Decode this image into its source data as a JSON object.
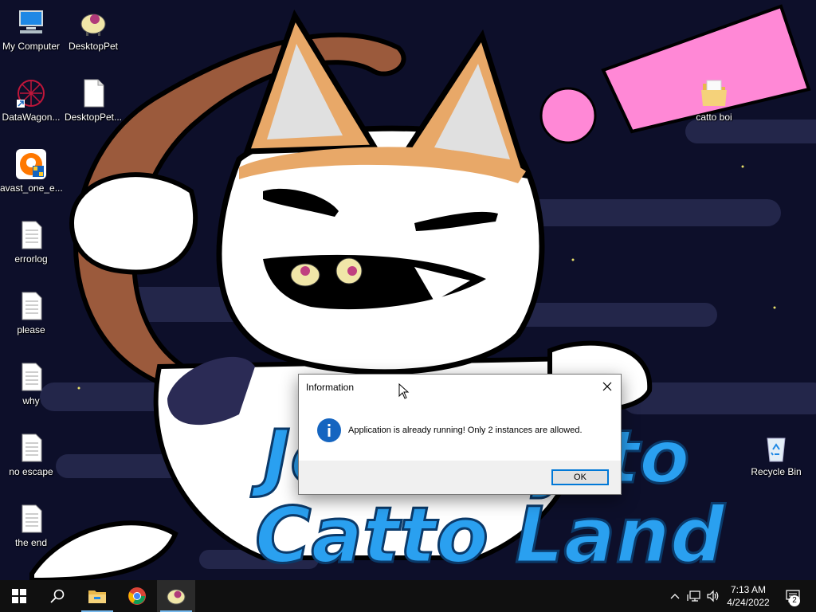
{
  "wallpaper": {
    "line1": "Journey to",
    "line2": "Catto Land"
  },
  "desktop_icons": [
    {
      "label": "My Computer",
      "icon": "computer-icon"
    },
    {
      "label": "DesktopPet",
      "icon": "sheep-icon"
    },
    {
      "label": "DataWagon...",
      "icon": "datawagon-icon"
    },
    {
      "label": "DesktopPet...",
      "icon": "document-icon"
    },
    {
      "label": "avast_one_e...",
      "icon": "avast-icon"
    },
    {
      "label": "errorlog",
      "icon": "text-file-icon"
    },
    {
      "label": "please",
      "icon": "text-file-icon"
    },
    {
      "label": "why",
      "icon": "text-file-icon"
    },
    {
      "label": "no escape",
      "icon": "text-file-icon"
    },
    {
      "label": "the end",
      "icon": "text-file-icon"
    },
    {
      "label": "catto boi",
      "icon": "folder-icon"
    },
    {
      "label": "Recycle Bin",
      "icon": "recycle-bin-icon"
    }
  ],
  "dialog": {
    "title": "Information",
    "message": "Application is already running! Only 2 instances are allowed.",
    "ok_label": "OK",
    "icon": "info-icon"
  },
  "taskbar": {
    "apps": [
      "start-icon",
      "search-icon",
      "file-explorer-icon",
      "chrome-icon",
      "desktoppet-icon"
    ],
    "time": "7:13 AM",
    "date": "4/24/2022",
    "notification_count": "2"
  },
  "colors": {
    "background": "#0d0f2a",
    "wallpaper_text": "#2aa0f0",
    "pink": "#ff88d6",
    "taskbar": "#101010",
    "accent": "#0078d7"
  }
}
